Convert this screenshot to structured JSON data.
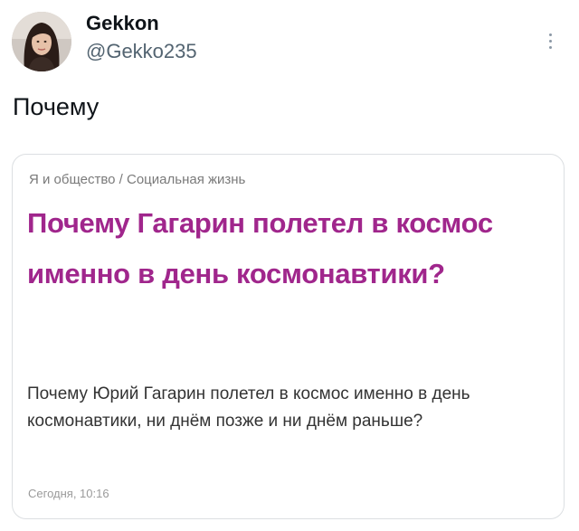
{
  "author": {
    "display_name": "Gekkon",
    "handle": "@Gekko235"
  },
  "tweet": {
    "text": "Почему"
  },
  "card": {
    "breadcrumb": "Я и общество / Социальная жизнь",
    "title": "Почему Гагарин полетел в космос именно в день космонавтики?",
    "body": "Почему Юрий Гагарин полетел в космос именно в день космонавтики, ни днём позже и ни днём раньше?",
    "timestamp": "Сегодня, 10:16"
  },
  "icons": {
    "more": "more-vertical-icon",
    "avatar": "profile-avatar"
  },
  "colors": {
    "title_accent": "#a0268c",
    "handle": "#536471",
    "card_border": "#dcdfe2"
  }
}
